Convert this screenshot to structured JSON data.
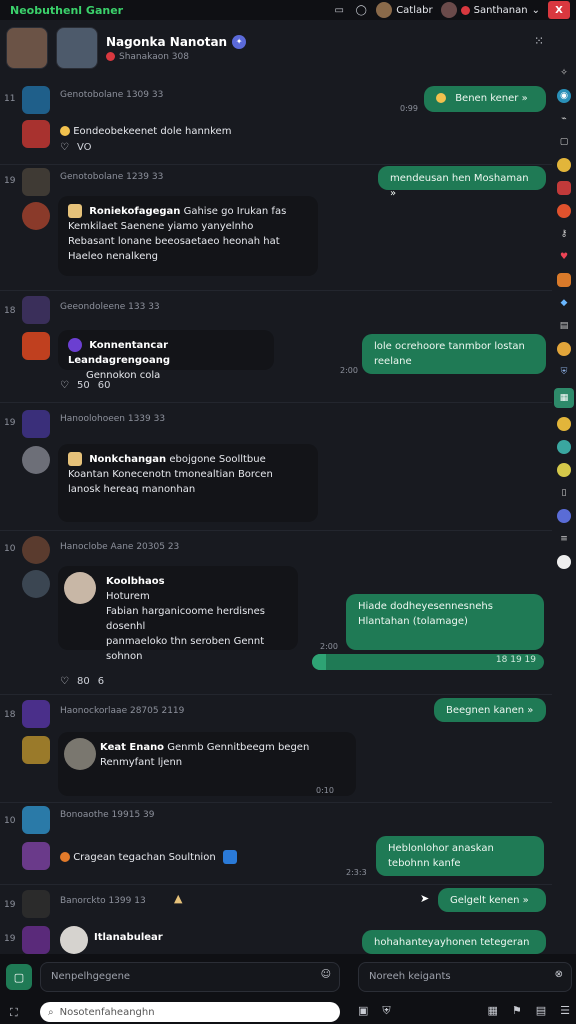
{
  "topbar": {
    "app_title": "Neobuthenl Ganer",
    "user1": "Catlabr",
    "user2": "Santhanan",
    "close": "X"
  },
  "header": {
    "name": "Nagonka Nanotan",
    "subtitle": "Shanakaon 308"
  },
  "messages": [
    {
      "num": "11",
      "meta": "Genotobolane 1309 33",
      "out_text": "Benen kener",
      "out_time": "0:99",
      "text": "Eondeobekeenet dole hannkem",
      "reactions": [
        "VO"
      ]
    },
    {
      "num": "19",
      "meta": "Genotobolane 1239 33",
      "out_text": "mendeusan hen Moshaman",
      "incoming_title": "Roniekofagegan",
      "incoming_lines": [
        "Gahise go Irukan fas",
        "Kemkilaet Saenene yiamo yanyelnho",
        "Rebasant lonane beeosaetaeo heonah hat",
        "Haeleo nenalkeng"
      ]
    },
    {
      "num": "18",
      "meta": "Geeondoleene 133 33",
      "incoming_title": "Konnentancar Leandagrengoang",
      "incoming_lines": [
        "Gennokon cola"
      ],
      "out_text": "lole ocrehoore tanmbor lostan reelane",
      "out_time": "2:00",
      "reactions": [
        "50",
        "60"
      ]
    },
    {
      "num": "19",
      "meta": "Hanoolohoeen 1339 33",
      "incoming_title": "Nonkchangan",
      "incoming_lines": [
        "ebojgone Soolltbue",
        "Koantan Konecenotn tmonealtian Borcen",
        "lanosk hereaq manonhan"
      ]
    },
    {
      "num": "10",
      "meta": "Hanoclobe Aane 20305 23",
      "incoming_title": "Koolbhaos",
      "incoming_lines": [
        "Hoturem",
        "Fabian harganicoome herdisnes dosenhl",
        "panmaeloko thn seroben Gennt",
        "sohnon"
      ],
      "out_text": "Hiade dodheyesennesnehs Hlantahan (tolamage)",
      "out_time": "2:00",
      "progress_label": "18 19 19",
      "progress_pct": 0.06,
      "reactions": [
        "80",
        "6"
      ]
    },
    {
      "num": "18",
      "meta": "Haonockorlaae 28705 2119",
      "out_text": "Beegnen kanen",
      "incoming_title": "Keat Enano",
      "incoming_lines": [
        "Genmb Gennitbeegm begen",
        "Renmyfant ljenn"
      ],
      "in_time": "0:10"
    },
    {
      "num": "10",
      "meta": "Bonoaothe 19915 39",
      "text": "Cragean tegachan Soultnion",
      "out_text": "Heblonlohor anaskan tebohnn kanfe",
      "out_time": "2:3:3"
    },
    {
      "num": "19",
      "meta": "Banorckto 1399 13",
      "out_text": "Gelgelt kenen"
    },
    {
      "num": "19",
      "incoming_title": "Itlanabulear",
      "out_text": "hohahanteyayhonen tetegeran"
    }
  ],
  "composer": {
    "message_placeholder": "Nenpelhgegene",
    "search_placeholder": "Noreeh keigants",
    "bottom_search": "Nosotenfaheanghn"
  },
  "colors": {
    "accent_green": "#1f7a55",
    "danger": "#d9383f",
    "background": "#181a20"
  }
}
